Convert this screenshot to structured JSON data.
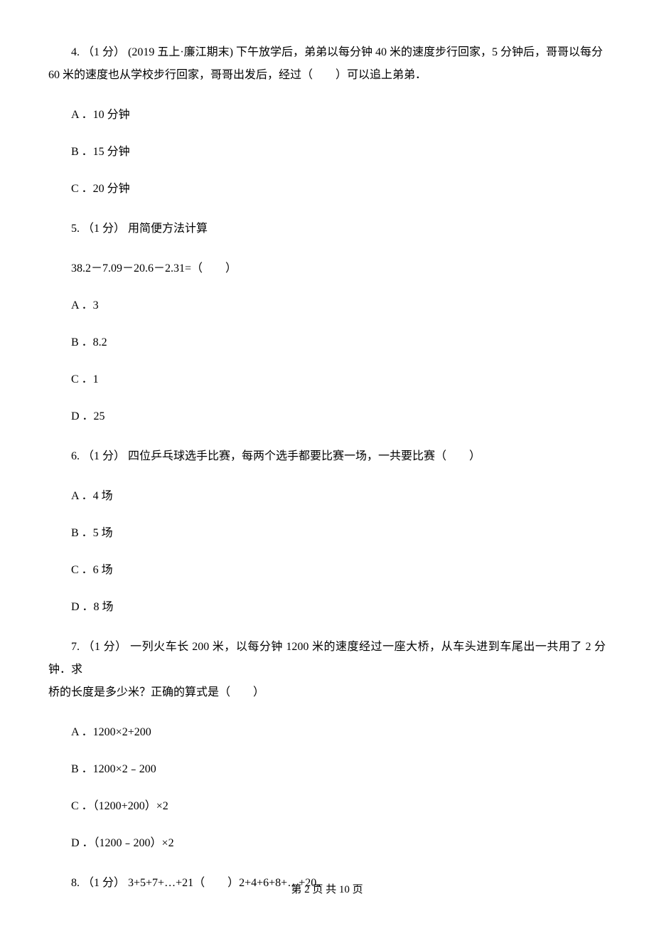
{
  "q4": {
    "line1": "4. （1 分） (2019 五上·廉江期末) 下午放学后，弟弟以每分钟 40 米的速度步行回家，5 分钟后，哥哥以每分",
    "line2": "60 米的速度也从学校步行回家，哥哥出发后，经过（　　）可以追上弟弟．",
    "optA": "A ．10 分钟",
    "optB": "B ．15 分钟",
    "optC": "C ．20 分钟"
  },
  "q5": {
    "line1": "5. （1 分）  用简便方法计算",
    "line2": "38.2－7.09－20.6－2.31=（　　）",
    "optA": "A ．3",
    "optB": "B ．8.2",
    "optC": "C ．1",
    "optD": "D ．25"
  },
  "q6": {
    "line1": "6. （1 分）  四位乒乓球选手比赛，每两个选手都要比赛一场，一共要比赛（　　）",
    "optA": "A ．4 场",
    "optB": "B ．5 场",
    "optC": "C ．6 场",
    "optD": "D ．8 场"
  },
  "q7": {
    "line1": "7. （1 分） 一列火车长 200 米，以每分钟 1200 米的速度经过一座大桥，从车头进到车尾出一共用了 2 分钟．求",
    "line2": "桥的长度是多少米？正确的算式是（　　）",
    "optA": "A ．1200×2+200",
    "optB": "B ．1200×2﹣200",
    "optC": "C ．（1200+200）×2",
    "optD": "D ．（1200﹣200）×2"
  },
  "q8": {
    "line1": "8. （1 分）  3+5+7+…+21（　　）2+4+6+8+…+20．"
  },
  "footer": "第 2 页 共 10 页"
}
